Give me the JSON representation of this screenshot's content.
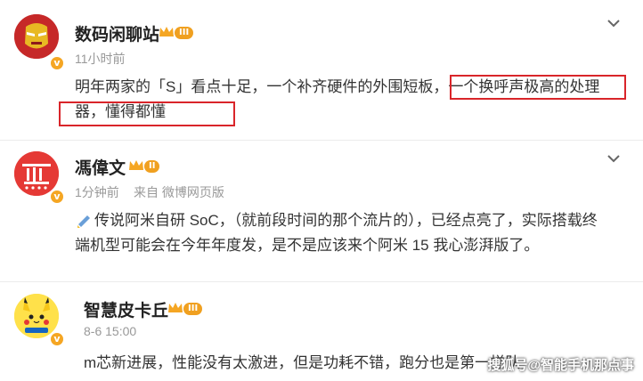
{
  "posts": [
    {
      "username": "数码闲聊站",
      "level": "III",
      "time": "11小时前",
      "source": "",
      "content_lines": [
        "明年两家的「S」看点十足，一个补齐硬件的外围短板，一个换呼声极高的处理",
        "器，懂得都懂"
      ],
      "avatar_icon": "iron-man-avatar-icon"
    },
    {
      "username": "馮偉文",
      "level": "II",
      "time": "1分钟前",
      "source": "来自 微博网页版",
      "content_lines": [
        "传说阿米自研 SoC，（就前段时间的那个流片的），已经点亮了，实际搭载终",
        "端机型可能会在今年年度发，是不是应该来个阿米 15 我心澎湃版了。"
      ],
      "avatar_icon": "red-character-avatar-icon"
    },
    {
      "username": "智慧皮卡丘",
      "level": "III",
      "time": "8-6 15:00",
      "source": "",
      "content_lines": [
        "m芯新进展，性能没有太激进，但是功耗不错，跑分也是第一梯队"
      ],
      "avatar_icon": "pikachu-avatar-icon"
    }
  ],
  "watermark": "搜狐号@智能手机那点事",
  "colors": {
    "highlight": "#d9252a",
    "badge": "#f5a623",
    "meta": "#999999"
  }
}
